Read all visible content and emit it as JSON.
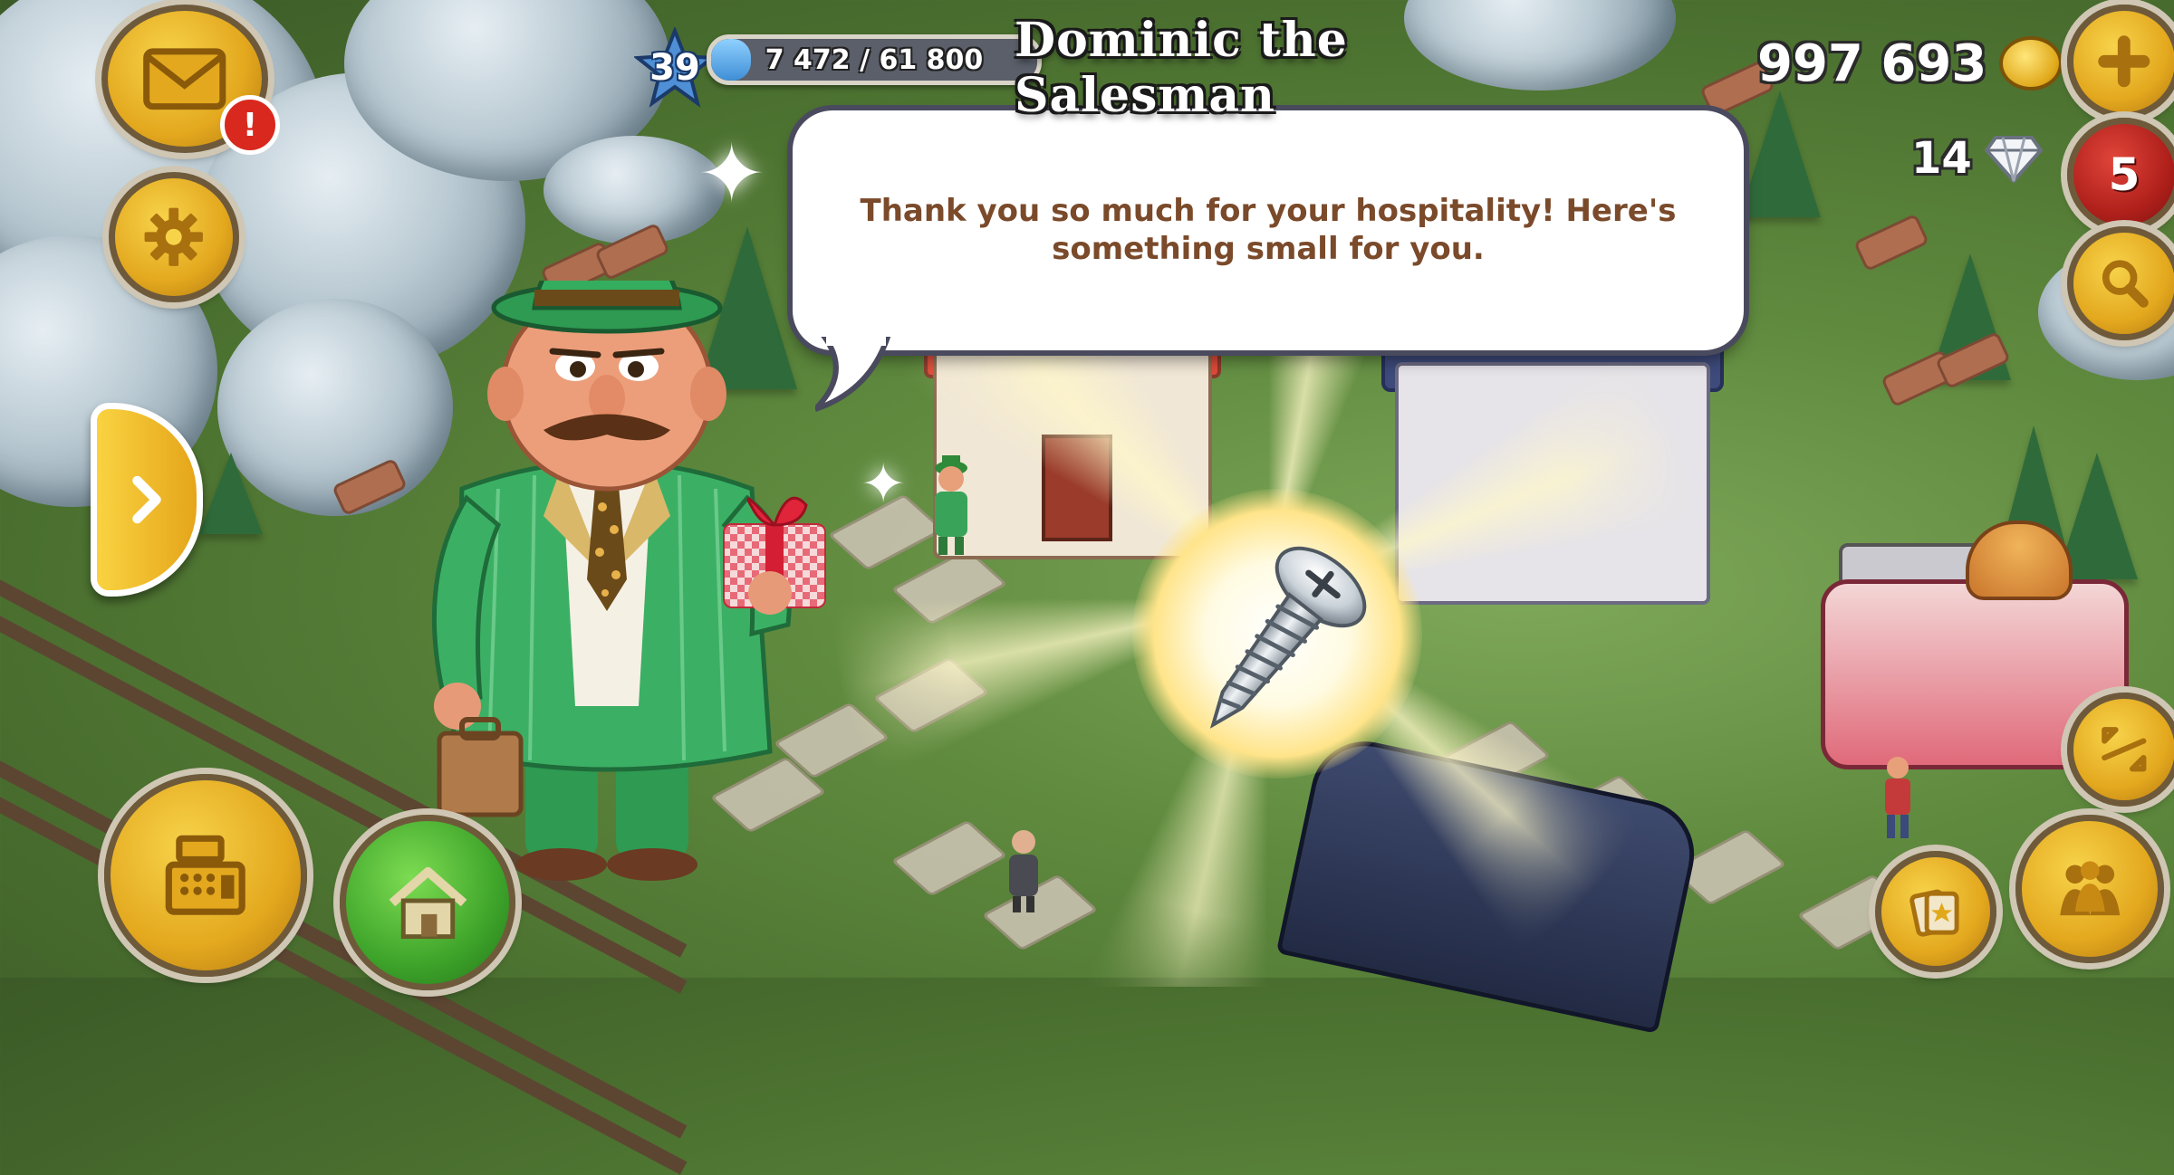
{
  "dialog": {
    "speaker_name": "Dominic the Salesman",
    "message": "Thank you so much for your hospitality! Here's something small for you."
  },
  "player": {
    "level": "39",
    "xp_text": "7 472 / 61 800",
    "xp_progress": 0.121,
    "coins": "997 693",
    "diamonds": "14"
  },
  "notifications": {
    "mail_alert": "!",
    "red_button_count": "5"
  },
  "reward": {
    "item_icon": "screw-icon"
  },
  "colors": {
    "accent_yellow": "#f7d34a",
    "dialog_text": "#7a4a2a",
    "xp_fill": "#3f8ed6"
  }
}
